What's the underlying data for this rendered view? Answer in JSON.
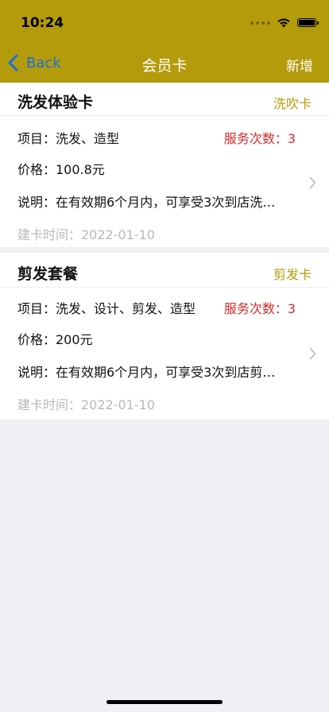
{
  "status_bar": {
    "time": "10:24",
    "icons": [
      "signal-dots-icon",
      "wifi-icon",
      "battery-icon"
    ]
  },
  "nav": {
    "back_label": "Back",
    "title": "会员卡",
    "action_label": "新增",
    "back_icon": "chevron-left-icon"
  },
  "colors": {
    "accent": "#b39b0c",
    "back_link": "#1a6fd6",
    "services_text": "#d62b2b",
    "muted_text": "#b8b8b8",
    "background": "#f0eff5"
  },
  "cards": [
    {
      "title": "洗发体验卡",
      "type": "洗吹卡",
      "items": "项目：洗发、造型",
      "services": "服务次数：3",
      "price": "价格：100.8元",
      "description": "说明：在有效期6个月内，可享受3次到店洗…",
      "created": "建卡时间：2022-01-10"
    },
    {
      "title": "剪发套餐",
      "type": "剪发卡",
      "items": "项目：洗发、设计、剪发、造型",
      "services": "服务次数：3",
      "price": "价格：200元",
      "description": "说明：在有效期6个月内，可享受3次到店剪…",
      "created": "建卡时间：2022-01-10"
    }
  ]
}
